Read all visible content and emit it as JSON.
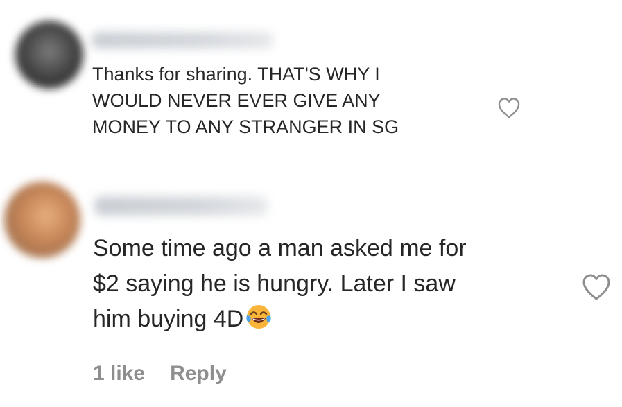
{
  "comments": [
    {
      "avatar_icon": "user-avatar-icon",
      "username": "",
      "text_lines": [
        "Thanks for sharing. THAT'S WHY I",
        "WOULD NEVER EVER GIVE ANY",
        "MONEY TO ANY STRANGER IN SG"
      ],
      "like_icon": "heart-outline-icon"
    },
    {
      "avatar_icon": "user-avatar-icon",
      "username": "",
      "text_lines": [
        "Some time ago a man asked me for",
        "$2 saying he is hungry. Later I saw",
        "him buying 4D"
      ],
      "emoji": "face-with-tears-of-joy-icon",
      "like_icon": "heart-outline-icon",
      "likes_label": "1 like",
      "reply_label": "Reply"
    }
  ],
  "colors": {
    "text": "#262626",
    "secondary_text": "#8e8e8e",
    "heart_stroke": "#8e8e8e"
  }
}
